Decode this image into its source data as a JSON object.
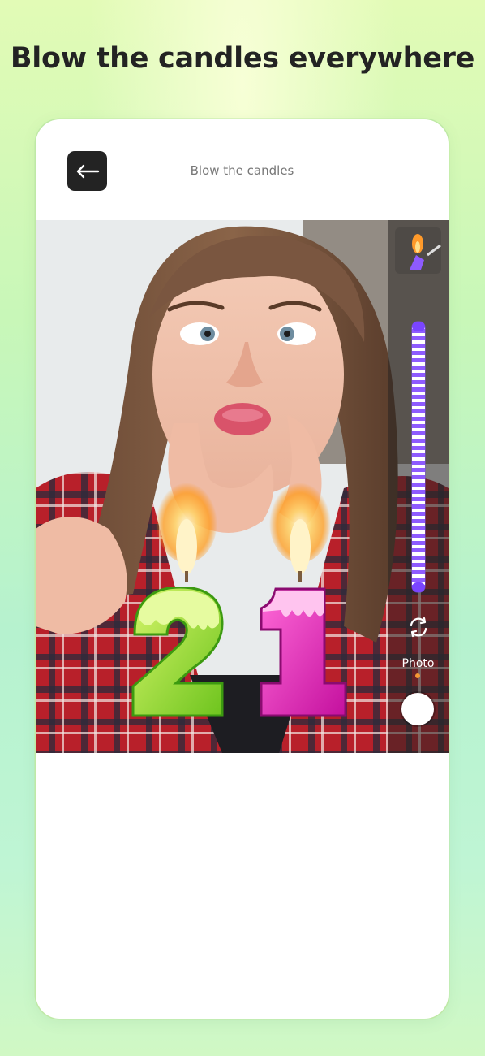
{
  "promo": {
    "headline": "Blow the candles everywhere"
  },
  "screen": {
    "title": "Blow the candles",
    "back_icon": "arrow-left-icon"
  },
  "camera": {
    "candle_numbers": [
      "2",
      "1"
    ],
    "candle_colors": {
      "first": "#a8e03a",
      "second": "#e81fc4"
    },
    "side_panel": {
      "effect_thumb_icon": "candle-effect-icon",
      "flip_icon": "camera-flip-icon",
      "mode_label": "Photo",
      "accent_color": "#8e5bff"
    }
  }
}
